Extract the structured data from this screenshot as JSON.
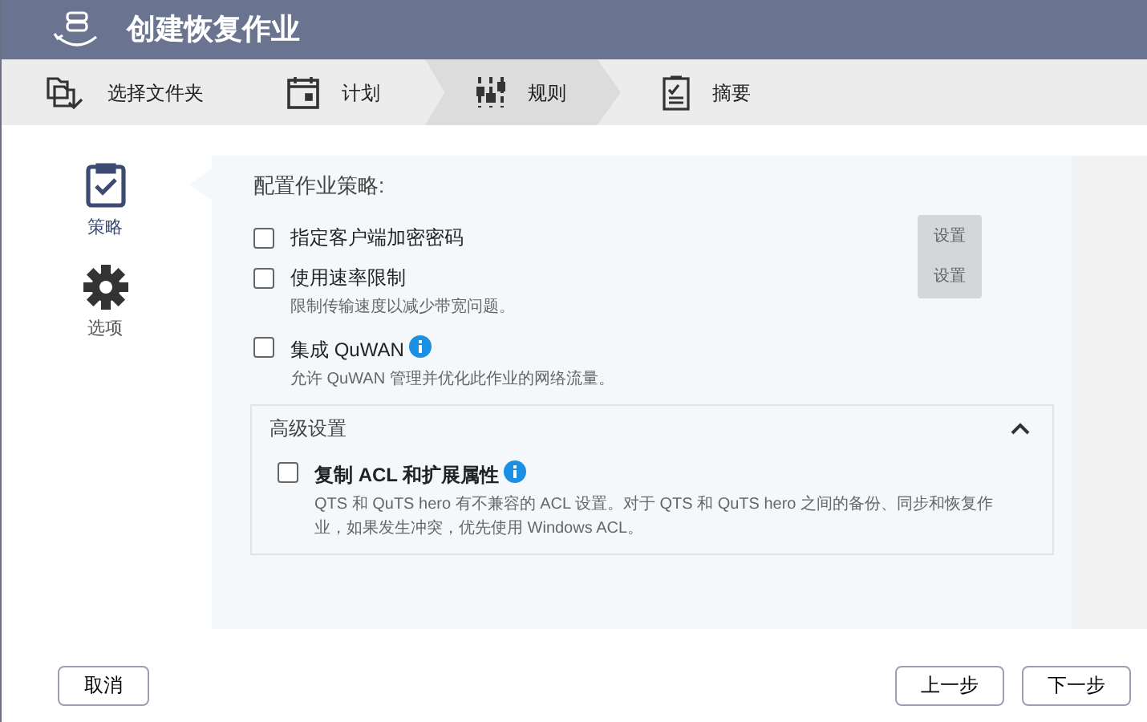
{
  "window": {
    "title": "创建恢复作业"
  },
  "steps": [
    {
      "label": "选择文件夹",
      "kind": "folder",
      "selected": false
    },
    {
      "label": "计划",
      "kind": "calendar",
      "selected": false
    },
    {
      "label": "规则",
      "kind": "sliders",
      "selected": true
    },
    {
      "label": "摘要",
      "kind": "clipboard",
      "selected": false
    }
  ],
  "sidebar": {
    "items": [
      {
        "label": "策略",
        "kind": "policy",
        "selected": true
      },
      {
        "label": "选项",
        "kind": "options",
        "selected": false
      }
    ]
  },
  "panel": {
    "heading": "配置作业策略:",
    "options": [
      {
        "label": "指定客户端加密密码",
        "checked": false,
        "button": "设置",
        "button_disabled": true
      },
      {
        "label": "使用速率限制",
        "checked": false,
        "description": "限制传输速度以减少带宽问题。",
        "button": "设置",
        "button_disabled": true
      },
      {
        "label": "集成 QuWAN",
        "checked": false,
        "info": true,
        "description": "允许 QuWAN 管理并优化此作业的网络流量。"
      }
    ],
    "advanced": {
      "title": "高级设置",
      "expanded": true,
      "options": [
        {
          "label": "复制 ACL 和扩展属性",
          "checked": false,
          "info": true,
          "description": "QTS 和 QuTS hero 有不兼容的 ACL 设置。对于 QTS 和 QuTS hero 之间的备份、同步和恢复作业，如果发生冲突，优先使用 Windows ACL。"
        }
      ]
    }
  },
  "buttons": {
    "cancel": "取消",
    "back": "上一步",
    "next": "下一步"
  }
}
